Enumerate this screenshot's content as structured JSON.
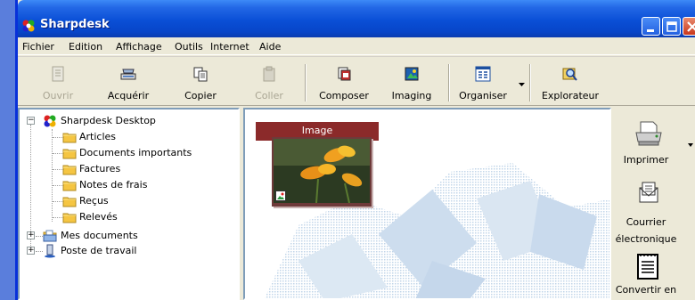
{
  "window": {
    "title": "Sharpdesk"
  },
  "menu": [
    "Fichier",
    "Edition",
    "Affichage",
    "Outils",
    "Internet",
    "Aide"
  ],
  "toolbar": {
    "open": "Ouvrir",
    "acquire": "Acquérir",
    "copy": "Copier",
    "paste": "Coller",
    "compose": "Composer",
    "imaging": "Imaging",
    "organize": "Organiser",
    "explorer": "Explorateur"
  },
  "tree": {
    "root": "Sharpdesk Desktop",
    "children": [
      "Articles",
      "Documents importants",
      "Factures",
      "Notes de frais",
      "Reçus",
      "Relevés"
    ],
    "my_documents": "Mes documents",
    "workstation": "Poste de travail"
  },
  "content": {
    "thumbnail_title": "Image"
  },
  "side": {
    "print": "Imprimer",
    "email_line1": "Courrier",
    "email_line2": "électronique",
    "convert": "Convertir en"
  },
  "colors": {
    "title_blue": "#0a4fd6",
    "thumb_header": "#8b2a2a",
    "folder": "#f5c542"
  }
}
